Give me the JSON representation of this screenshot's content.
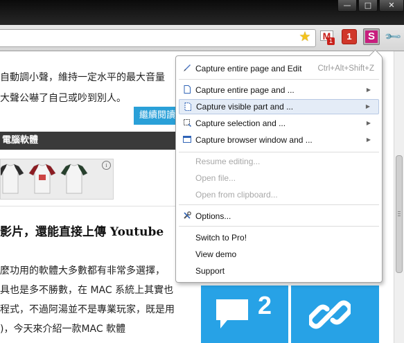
{
  "window": {
    "controls": {
      "minimize": "—",
      "maximize": "□",
      "close": "✕"
    }
  },
  "toolbar": {
    "star_icon": "star-icon",
    "gmail_label": "M",
    "gmail_badge": "1",
    "red_ext_label": "1",
    "snagit_label": "S",
    "wrench_icon": "wrench-icon"
  },
  "page": {
    "lines_top": [
      "自動調小聲，維持一定水平的最大音量",
      "大聲公嚇了自己或吵到別人。"
    ],
    "read_more": "繼續閱讀",
    "category": "電腦軟體",
    "ad_info": "i",
    "post_title": "影片，還能直接上傳 Youtube",
    "body_lines": [
      "麼功用的軟體大多數都有非常多選擇，",
      "具也是多不勝數，在 MAC 系統上其實也",
      "程式，不過阿湯並不是專業玩家，既是用",
      ")，今天來介紹一款MAC 軟體"
    ],
    "comment_count": "2"
  },
  "menu": {
    "items": [
      {
        "label": "Capture entire page and Edit",
        "shortcut": "Ctrl+Alt+Shift+Z",
        "icon": "pen-icon"
      },
      {
        "label": "Capture entire page and ...",
        "icon": "page-icon"
      },
      {
        "label": "Capture visible part and ...",
        "icon": "visible-page-icon"
      },
      {
        "label": "Capture selection and ...",
        "icon": "selection-icon"
      },
      {
        "label": "Capture browser window and ...",
        "icon": "window-icon"
      },
      {
        "label": "Resume editing..."
      },
      {
        "label": "Open file..."
      },
      {
        "label": "Open from clipboard..."
      },
      {
        "label": "Options...",
        "icon": "tools-icon"
      },
      {
        "label": "Switch to Pro!"
      },
      {
        "label": "View demo"
      },
      {
        "label": "Support"
      }
    ]
  },
  "colors": {
    "accent_blue": "#27a2e6",
    "menu_highlight": "#e4ecf7",
    "snagit_pink": "#c81e7e",
    "gmail_red": "#c8201a"
  }
}
